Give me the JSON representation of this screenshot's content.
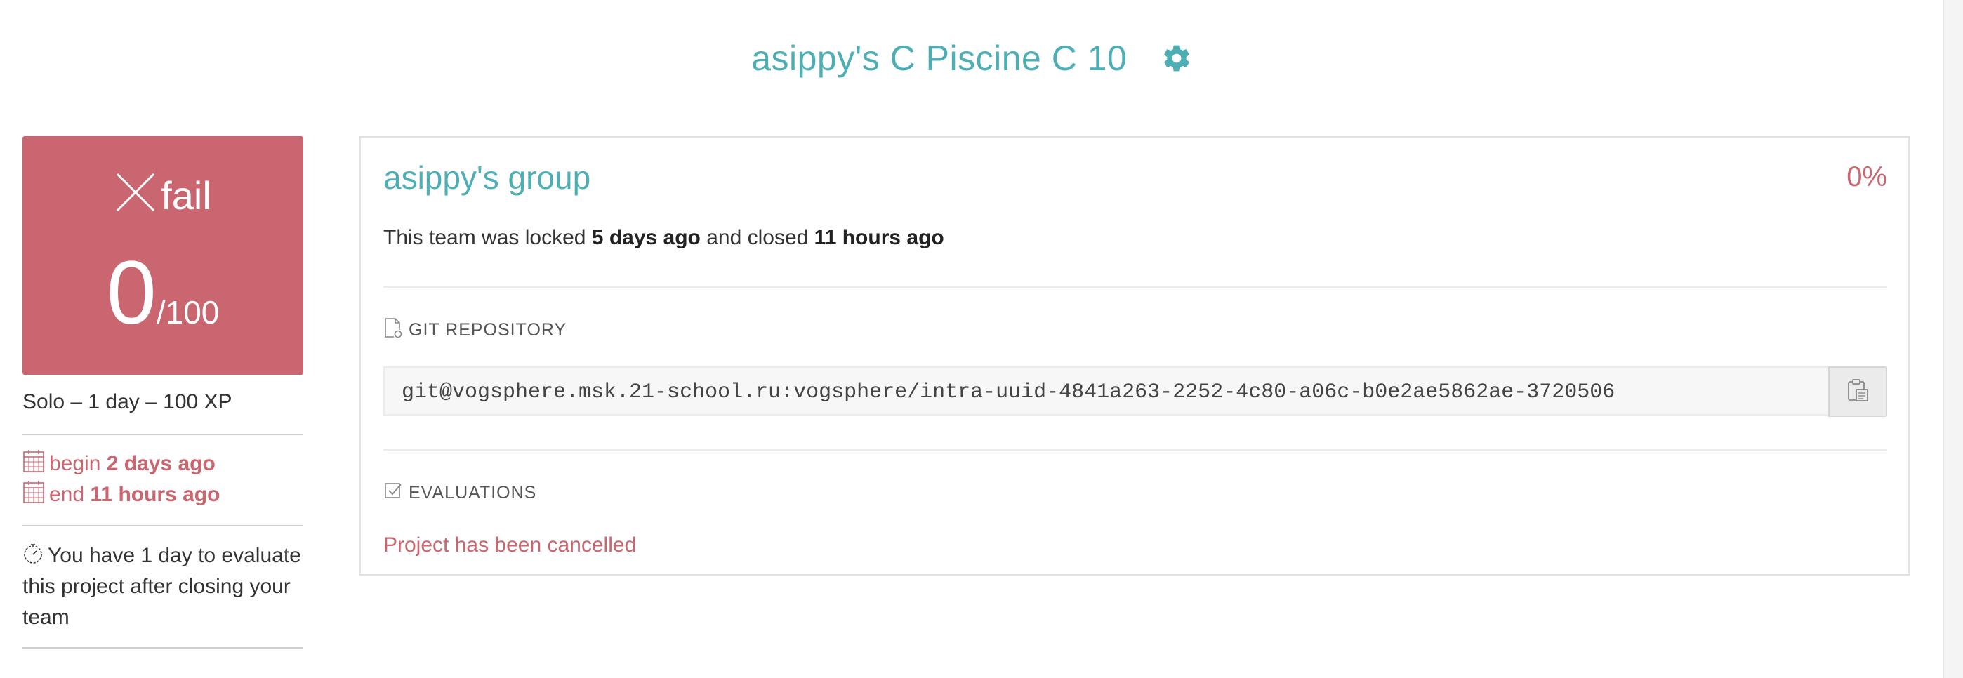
{
  "header": {
    "title": "asippy's C Piscine C 10",
    "settings_icon": "gear-icon"
  },
  "colors": {
    "teal": "#4dafb3",
    "fail_red": "#c9666f"
  },
  "score": {
    "status": "fail",
    "status_icon": "close-icon",
    "value": "0",
    "max": "/100"
  },
  "project_meta": "Solo – 1 day – 100 XP",
  "dates": {
    "begin_label": "begin",
    "begin_value": "2 days ago",
    "end_label": "end",
    "end_value": "11 hours ago"
  },
  "evaluation_note": "You have 1 day to evaluate this project after closing your team",
  "group": {
    "name": "asippy's group",
    "percent": "0%",
    "locked_prefix": "This team was locked",
    "locked_when": "5 days ago",
    "closed_prefix": "and closed",
    "closed_when": "11 hours ago"
  },
  "git": {
    "label": "GIT REPOSITORY",
    "url": "git@vogsphere.msk.21-school.ru:vogsphere/intra-uuid-4841a263-2252-4c80-a06c-b0e2ae5862ae-3720506",
    "copy_icon": "clipboard-icon"
  },
  "evaluations": {
    "label": "EVALUATIONS",
    "status": "Project has been cancelled"
  }
}
